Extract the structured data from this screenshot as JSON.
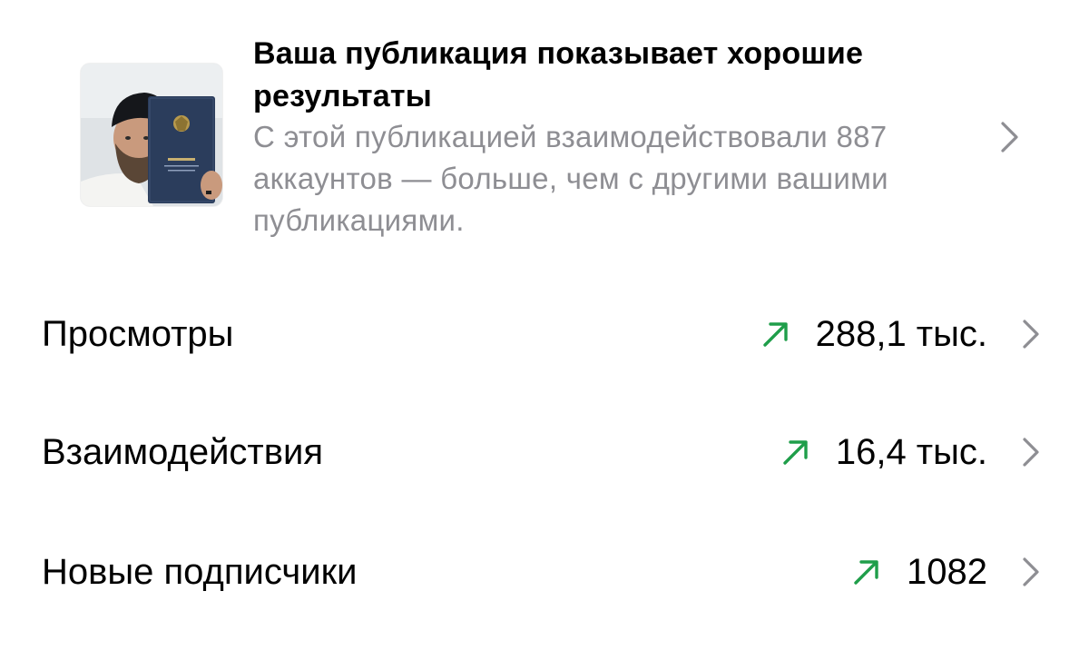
{
  "post_card": {
    "thumbnail_icon": "post-thumbnail-image",
    "title": "Ваша публикация показывает хорошие результаты",
    "description": "С этой публикацией взаимодействовали 887 аккаунтов — больше, чем с другими вашими публикациями."
  },
  "stats": [
    {
      "label": "Просмотры",
      "value": "288,1 тыс.",
      "trend_icon": "trend-up-arrow-icon"
    },
    {
      "label": "Взаимодействия",
      "value": "16,4 тыс.",
      "trend_icon": "trend-up-arrow-icon"
    },
    {
      "label": "Новые подписчики",
      "value": "1082",
      "trend_icon": "trend-up-arrow-icon"
    }
  ],
  "colors": {
    "text_primary": "#000000",
    "text_secondary": "#8e8e93",
    "trend_up": "#1f9e4a",
    "chevron": "#8e8e93",
    "background": "#ffffff"
  }
}
